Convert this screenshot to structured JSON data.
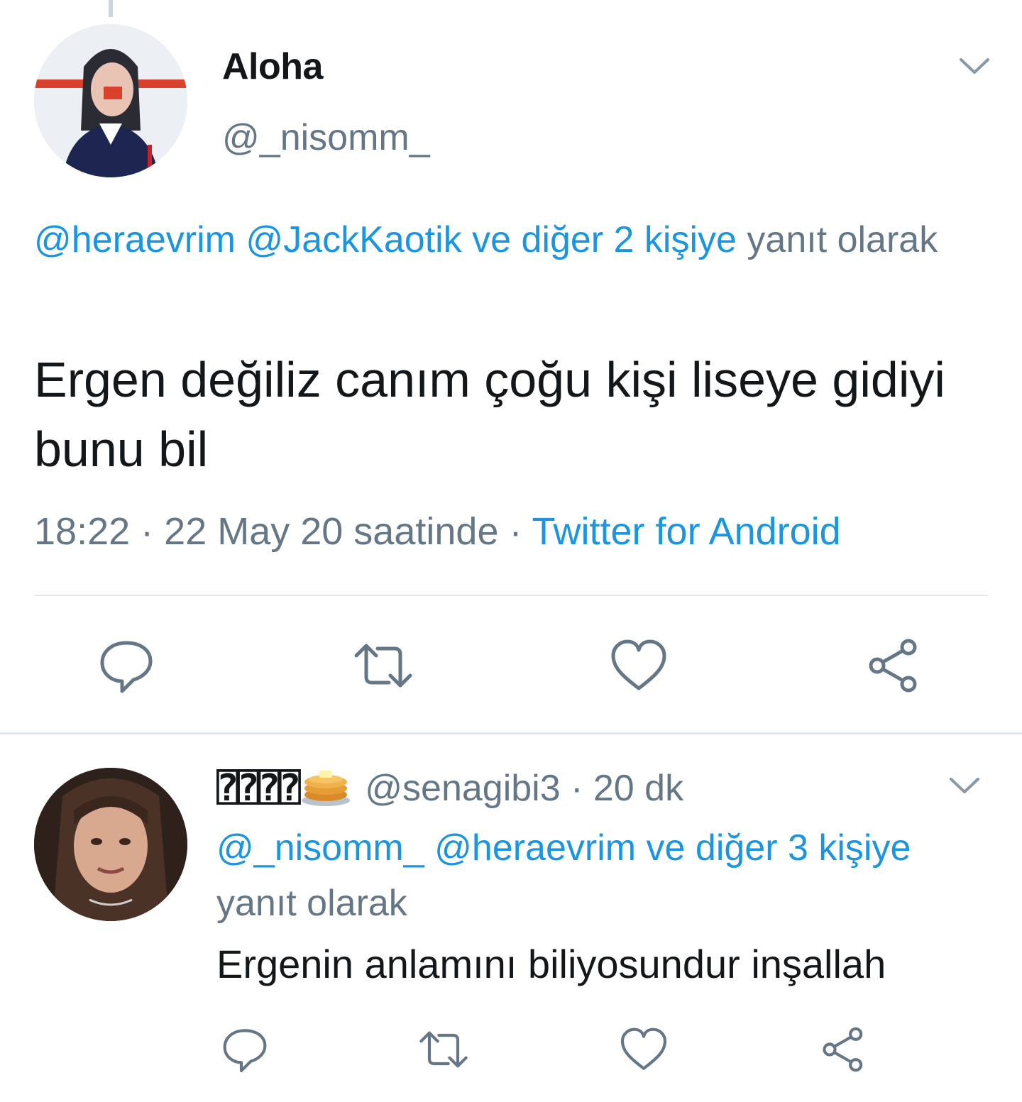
{
  "main_tweet": {
    "author_name": "Aloha",
    "author_handle": "@_nisomm_",
    "reply_context": {
      "links": [
        "@heraevrim",
        "@JackKaotik",
        "ve diğer 2 kişiye"
      ],
      "suffix": "yanıt olarak"
    },
    "text": "Ergen değiliz canım çoğu kişi liseye gidiyi bunu bil",
    "time": "18:22",
    "date_label": "22 May 20 saatinde",
    "source": "Twitter for Android",
    "separator": "·",
    "avatar_icon": "avatar-photo-icon",
    "menu_icon": "chevron-down-icon"
  },
  "reply_tweet": {
    "author_name": "⍰⍰⍰⍰",
    "author_emoji": "pancakes-emoji",
    "author_handle": "@senagibi3",
    "separator": "·",
    "time_ago": "20 dk",
    "reply_context": {
      "links": [
        "@_nisomm_",
        "@heraevrim",
        "ve diğer 3 kişiye"
      ],
      "suffix": "yanıt olarak"
    },
    "text": "Ergenin anlamını biliyosundur inşallah",
    "avatar_icon": "avatar-photo-icon",
    "menu_icon": "chevron-down-icon"
  },
  "actions": [
    "reply-icon",
    "retweet-icon",
    "like-icon",
    "share-icon"
  ],
  "colors": {
    "link": "#1b95e0",
    "muted": "#657786",
    "text": "#14171a",
    "divider": "#e1e8ed"
  }
}
